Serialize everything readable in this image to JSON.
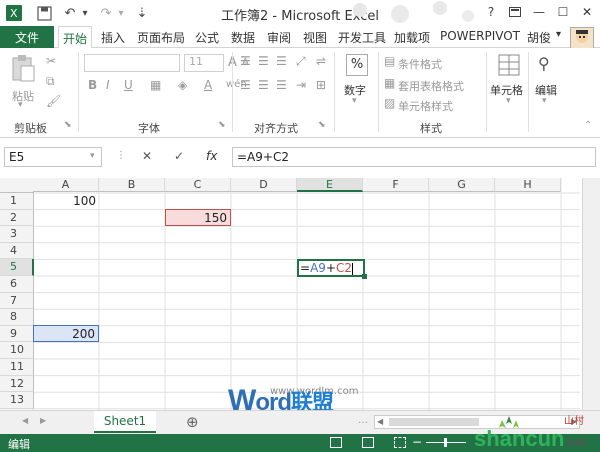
{
  "title_bar": {
    "title": "工作簿2 - Microsoft Excel",
    "help": "?",
    "minimize": "—",
    "maximize": "☐",
    "close": "✕"
  },
  "quick_access": {
    "undo": "↶",
    "redo": "↷",
    "undo_dropdown": "▾",
    "redo_dropdown": "▾",
    "customize": "⇣"
  },
  "ribbon_tabs": [
    "文件",
    "开始",
    "插入",
    "页面布局",
    "公式",
    "数据",
    "审阅",
    "视图",
    "开发工具",
    "加载项",
    "POWERPIVOT"
  ],
  "user_name": "胡俊",
  "ribbon": {
    "clipboard": {
      "paste": "粘贴",
      "label": "剪贴板"
    },
    "font": {
      "size": "11",
      "label": "字体",
      "bold": "B",
      "italic": "I",
      "underline": "U",
      "grow": "A",
      "shrink": "A",
      "color": "A",
      "wen": "wén"
    },
    "alignment": {
      "label": "对齐方式"
    },
    "number": {
      "button": "数字",
      "symbol": "%"
    },
    "styles": {
      "conditional": "条件格式",
      "table": "套用表格格式",
      "cell": "单元格样式",
      "label": "样式"
    },
    "cells": {
      "button": "单元格"
    },
    "editing": {
      "button": "编辑"
    }
  },
  "formula_bar": {
    "name_box": "E5",
    "cancel": "✕",
    "enter": "✓",
    "fx": "fx",
    "formula": "=A9+C2"
  },
  "grid": {
    "columns": [
      "A",
      "B",
      "C",
      "D",
      "E",
      "F",
      "G",
      "H"
    ],
    "rows": [
      "1",
      "2",
      "3",
      "4",
      "5",
      "6",
      "7",
      "8",
      "9",
      "10",
      "11",
      "12",
      "13"
    ],
    "cells": {
      "A1": "100",
      "C2": "150",
      "A9": "200",
      "E5_prefix": "=",
      "E5_ref1": "A9",
      "E5_plus": "+",
      "E5_ref2": "C2"
    }
  },
  "sheet_tabs": {
    "active": "Sheet1",
    "add": "⊕",
    "prev": "◀",
    "next": "▶",
    "more": "…"
  },
  "watermark": {
    "site": "www.wordlm.com",
    "brand_w": "W",
    "brand_rest": "ord",
    "brand_cn": "联盟",
    "shan_site": "shancun",
    "shan_net": ".net",
    "shan_cn": "山村"
  },
  "status_bar": {
    "mode": "编辑",
    "zoom_minus": "−",
    "zoom_plus": "+"
  },
  "colors": {
    "excel_green": "#217346",
    "ref1_blue": "#4472c4",
    "ref2_red": "#c0504d",
    "ref1_fill": "#dbe5f6",
    "ref2_fill": "#f8dcdc"
  }
}
